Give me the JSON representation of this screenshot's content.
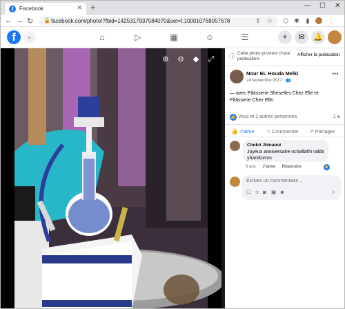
{
  "browser": {
    "tab_title": "Facebook",
    "url": "facebook.com/photo/?fbid=1425317937584070&set=t.100010768057678"
  },
  "photo_alt": "",
  "panel": {
    "info_text": "Cette photo provient d’une publication.",
    "info_button": "Afficher la publication",
    "author": "Nour EL Houda Melki",
    "date": "24 septembre 2017 · ",
    "post_text": "— avec Pâtisserie Sheselles Chez Elle et Pâtisserie Chez Elle.",
    "reactions_text": "Vous et 2 autres personnes",
    "comment_count": "1",
    "like_label": "J’aime",
    "comment_label": "Commenter",
    "share_label": "Partager",
    "comment": {
      "author": "Chokri Jhinaoui",
      "text": "Joyeux anniversaire nchallahh rabbi yhanikomm",
      "age": "6 ans",
      "like": "J’aime",
      "reply": "Répondre"
    },
    "write_placeholder": "Écrivez un commentaire…"
  },
  "icons": {
    "tab_favicon": "facebook-icon",
    "reaction": "like-icon"
  },
  "colors": {
    "facebook_blue": "#1877f2",
    "photo_bg": "#000000"
  }
}
